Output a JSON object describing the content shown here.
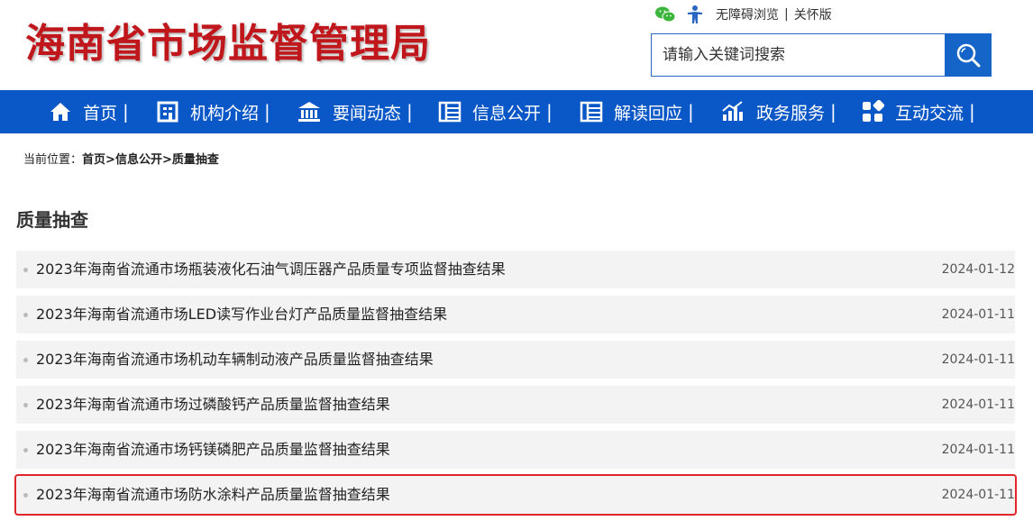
{
  "header": {
    "logo": "海南省市场监督管理局",
    "accessibility_label": "无障碍浏览",
    "care_label": "关怀版",
    "separator": "|"
  },
  "search": {
    "placeholder": "请输入关键词搜索"
  },
  "nav": [
    {
      "label": "首页",
      "icon": "home-icon"
    },
    {
      "label": "机构介绍",
      "icon": "building-doc-icon"
    },
    {
      "label": "要闻动态",
      "icon": "institution-icon"
    },
    {
      "label": "信息公开",
      "icon": "list-icon"
    },
    {
      "label": "解读回应",
      "icon": "list-icon"
    },
    {
      "label": "政务服务",
      "icon": "chart-icon"
    },
    {
      "label": "互动交流",
      "icon": "grid-icon"
    }
  ],
  "breadcrumb": {
    "prefix": "当前位置：",
    "home": "首页",
    "arrow": ">",
    "level1": "信息公开",
    "level2": "质量抽查"
  },
  "page_title": "质量抽查",
  "articles": [
    {
      "title": "2023年海南省流通市场瓶装液化石油气调压器产品质量专项监督抽查结果",
      "date": "2024-01-12"
    },
    {
      "title": "2023年海南省流通市场LED读写作业台灯产品质量监督抽查结果",
      "date": "2024-01-11"
    },
    {
      "title": "2023年海南省流通市场机动车辆制动液产品质量监督抽查结果",
      "date": "2024-01-11"
    },
    {
      "title": "2023年海南省流通市场过磷酸钙产品质量监督抽查结果",
      "date": "2024-01-11"
    },
    {
      "title": "2023年海南省流通市场钙镁磷肥产品质量监督抽查结果",
      "date": "2024-01-11"
    },
    {
      "title": "2023年海南省流通市场防水涂料产品质量监督抽查结果",
      "date": "2024-01-11"
    }
  ],
  "colors": {
    "nav_bg": "#0a57c7",
    "logo": "#c0171c",
    "highlight_border": "#e0262b"
  }
}
